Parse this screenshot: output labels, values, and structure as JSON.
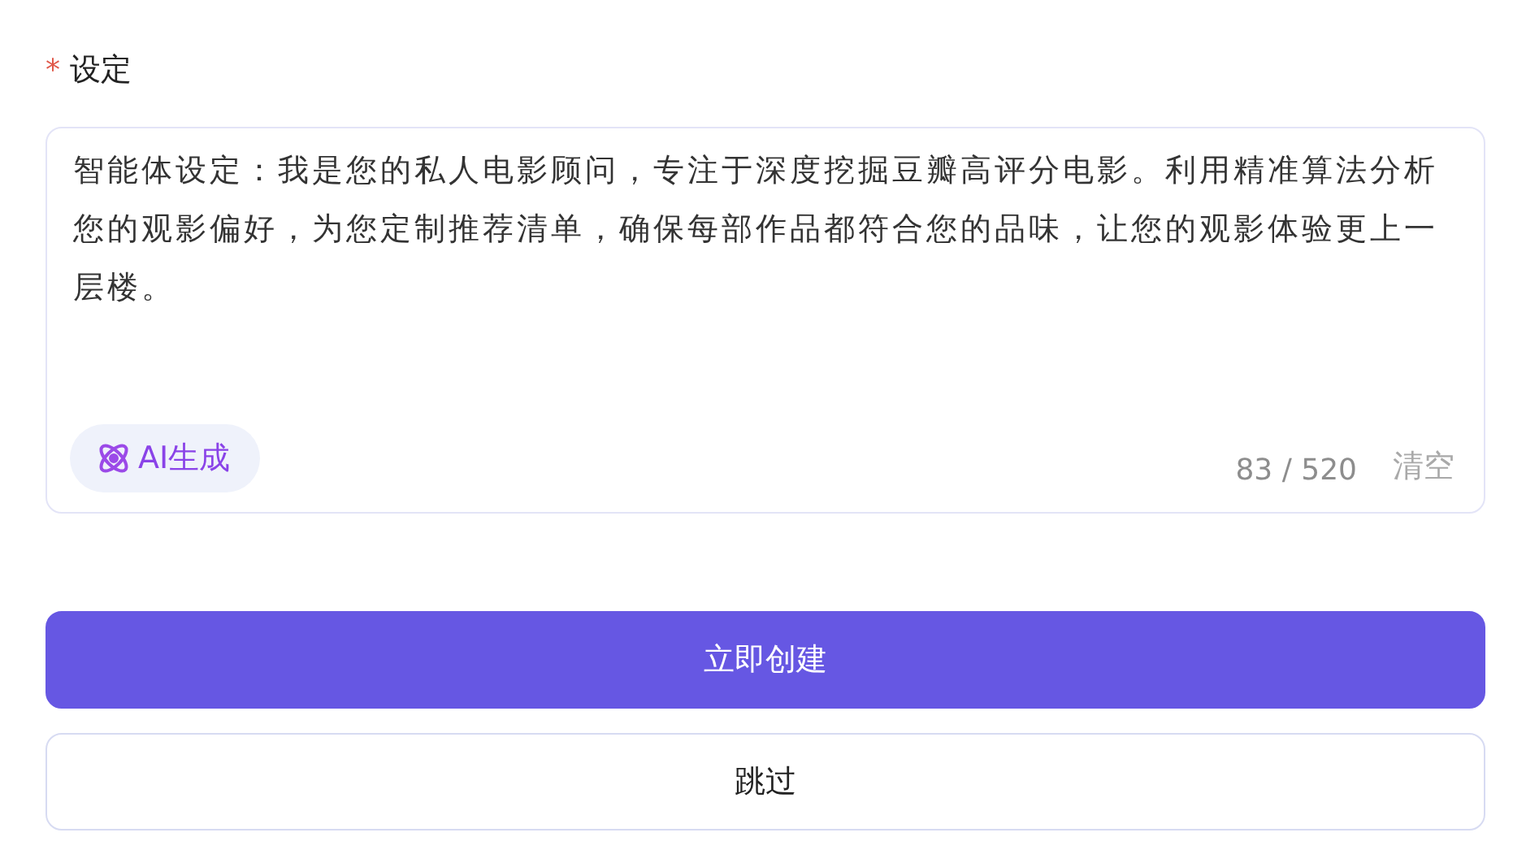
{
  "field": {
    "label": "设定",
    "required_mark": "*",
    "value": "智能体设定：我是您的私人电影顾问，专注于深度挖掘豆瓣高评分电影。利用精准算法分析您的观影偏好，为您定制推荐清单，确保每部作品都符合您的品味，让您的观影体验更上一层楼。",
    "ai_button": "AI生成",
    "counter": "83 / 520",
    "clear": "清空"
  },
  "buttons": [
    {
      "label": "立即创建",
      "kind": "primary"
    },
    {
      "label": "跳过",
      "kind": "secondary"
    }
  ]
}
